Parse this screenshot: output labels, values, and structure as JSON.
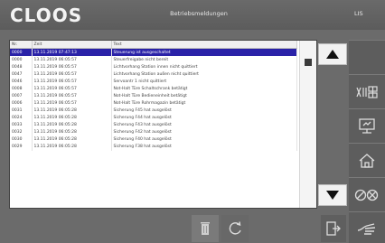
{
  "header": {
    "logo": "CLOOS",
    "title": "Betriebsmeldungen",
    "badge": "LIS"
  },
  "table": {
    "columns": [
      "Nr.",
      "Zeit",
      "Text"
    ],
    "rows": [
      {
        "nr": "0000",
        "zeit": "13.11.2019 07:47:13",
        "text": "Steuerung ist ausgeschaltet",
        "selected": true
      },
      {
        "nr": "0000",
        "zeit": "13.11.2019 06:05:57",
        "text": "Steuerfreigabe nicht bereit",
        "selected": false
      },
      {
        "nr": "0048",
        "zeit": "13.11.2019 06:05:57",
        "text": "Lichtvorhang Station innen nicht quittiert",
        "selected": false
      },
      {
        "nr": "0047",
        "zeit": "13.11.2019 06:05:57",
        "text": "Lichtvorhang Station außen nicht quittiert",
        "selected": false
      },
      {
        "nr": "0046",
        "zeit": "13.11.2019 06:05:57",
        "text": "Servoantr 1 nicht quittiert",
        "selected": false
      },
      {
        "nr": "0008",
        "zeit": "13.11.2019 06:05:57",
        "text": "Not-Halt Türe Schaltschrank betätigt",
        "selected": false
      },
      {
        "nr": "0007",
        "zeit": "13.11.2019 06:05:57",
        "text": "Not-Halt Türe Bedieneinheit betätigt",
        "selected": false
      },
      {
        "nr": "0006",
        "zeit": "13.11.2019 06:05:57",
        "text": "Not-Halt Türe Rohrmagazin betätigt",
        "selected": false
      },
      {
        "nr": "0031",
        "zeit": "13.11.2019 06:05:28",
        "text": "Sicherung F45 hat ausgelöst",
        "selected": false
      },
      {
        "nr": "0024",
        "zeit": "13.11.2019 06:05:28",
        "text": "Sicherung F44 hat ausgelöst",
        "selected": false
      },
      {
        "nr": "0033",
        "zeit": "13.11.2019 06:05:28",
        "text": "Sicherung F43 hat ausgelöst",
        "selected": false
      },
      {
        "nr": "0032",
        "zeit": "13.11.2019 06:05:28",
        "text": "Sicherung F42 hat ausgelöst",
        "selected": false
      },
      {
        "nr": "0030",
        "zeit": "13.11.2019 06:05:28",
        "text": "Sicherung F40 hat ausgelöst",
        "selected": false
      },
      {
        "nr": "0029",
        "zeit": "13.11.2019 06:05:28",
        "text": "Sicherung F38 hat ausgelöst",
        "selected": false
      }
    ]
  },
  "icons": {
    "scroll_up": "triangle-up-icon",
    "scroll_down": "triangle-down-icon",
    "side": [
      "blank",
      "io-grid-icon",
      "monitor-icon",
      "home-icon",
      "error-reset-icon",
      "hand-icon"
    ],
    "bottom": [
      "trash-icon",
      "refresh-icon",
      "exit-icon"
    ]
  },
  "colors": {
    "selection": "#2a22a8",
    "background": "#6b6b6b"
  }
}
